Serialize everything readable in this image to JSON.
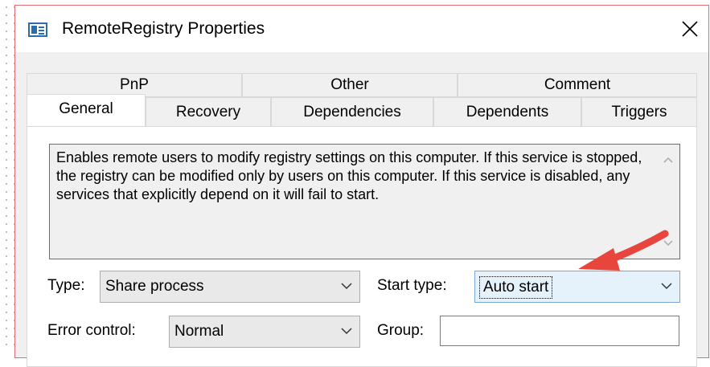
{
  "window": {
    "title": "RemoteRegistry Properties",
    "accent_color": "#2b6cb0",
    "title_icon": "service-properties-icon",
    "close_icon": "close-icon"
  },
  "tabs": {
    "row1": [
      "PnP",
      "Other",
      "Comment"
    ],
    "row2": [
      "General",
      "Recovery",
      "Dependencies",
      "Dependents",
      "Triggers"
    ],
    "active": "General"
  },
  "general": {
    "description": "Enables remote users to modify registry settings on this computer. If this service is stopped, the registry can be modified only by users on this computer. If this service is disabled, any services that explicitly depend on it will fail to start.",
    "type_label": "Type:",
    "type_value": "Share process",
    "start_type_label": "Start type:",
    "start_type_value": "Auto start",
    "error_control_label": "Error control:",
    "error_control_value": "Normal",
    "group_label": "Group:",
    "group_value": ""
  },
  "annotation": {
    "arrow_color": "#e8463c",
    "points_to": "start-type-select"
  }
}
